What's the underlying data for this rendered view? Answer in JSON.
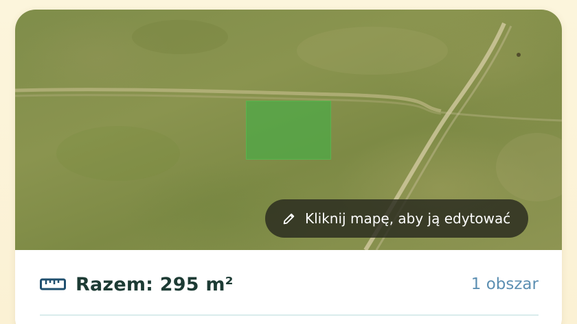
{
  "map": {
    "edit_hint": "Kliknij mapę, aby ją edytować",
    "edit_icon": "pencil-icon",
    "selection_color": "#4caa46"
  },
  "summary": {
    "icon": "ruler-icon",
    "total": "Razem: 295 m²",
    "area_count": "1 obszar"
  },
  "colors": {
    "accent": "#5c8fb2",
    "title": "#1d3b34",
    "background": "#fbf3d9"
  }
}
